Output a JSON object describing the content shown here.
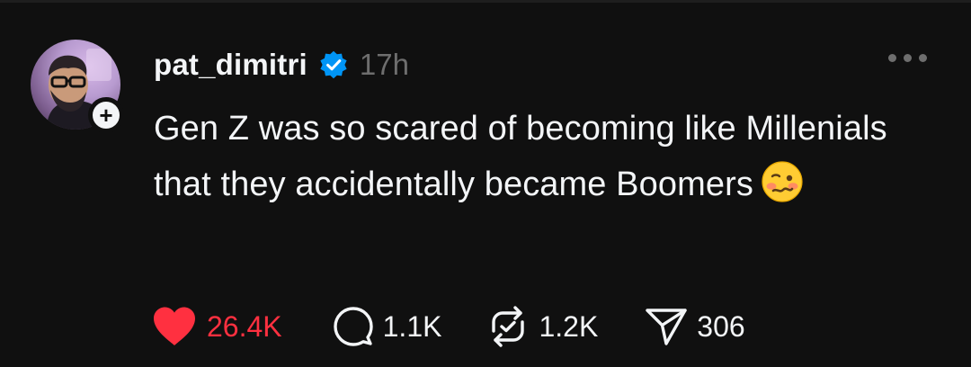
{
  "post": {
    "username": "pat_dimitri",
    "time": "17h",
    "text": "Gen Z was so scared of becoming like Millenials that they accidentally became Boomers",
    "emoji_icon": "woozy-face-icon"
  },
  "stats": {
    "likes": "26.4K",
    "replies": "1.1K",
    "reposts": "1.2K",
    "shares": "306"
  },
  "colors": {
    "background": "#101010",
    "text": "#f3f5f7",
    "muted": "#6e6e6e",
    "like": "#ff3040",
    "verified": "#0095f6"
  },
  "icons": {
    "follow": "plus-icon",
    "verified": "verified-badge-icon",
    "more": "ellipsis-icon",
    "like": "heart-icon",
    "reply": "comment-bubble-icon",
    "repost": "repost-icon",
    "share": "send-icon"
  }
}
